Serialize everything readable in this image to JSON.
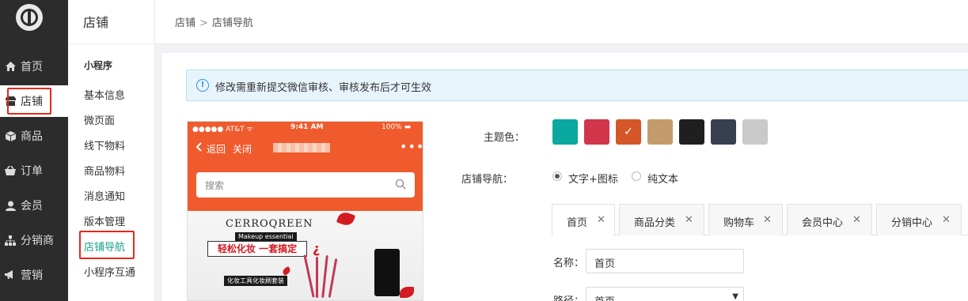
{
  "nav": {
    "items": [
      {
        "label": "首页",
        "icon": "home-icon"
      },
      {
        "label": "店铺",
        "icon": "store-icon"
      },
      {
        "label": "商品",
        "icon": "box-icon"
      },
      {
        "label": "订单",
        "icon": "basket-icon"
      },
      {
        "label": "会员",
        "icon": "user-icon"
      },
      {
        "label": "分销商",
        "icon": "sitemap-icon"
      },
      {
        "label": "营销",
        "icon": "megaphone-icon"
      }
    ]
  },
  "sub": {
    "title": "店铺",
    "group": "小程序",
    "items": [
      "基本信息",
      "微页面",
      "线下物料",
      "商品物料",
      "消息通知",
      "版本管理",
      "店铺导航",
      "小程序互通"
    ]
  },
  "breadcrumb": {
    "parent": "店铺",
    "current": "店铺导航",
    "separator": ">"
  },
  "notice": {
    "text": "修改需重新提交微信审核、审核发布后才可生效"
  },
  "preview": {
    "carrier": "●●●●● AT&T ᯤ",
    "time": "9:41 AM",
    "battery": "100% ▬",
    "back": "返回",
    "close": "关闭",
    "more": "•••",
    "search_placeholder": "搜索",
    "banner_brand": "CERROQREEN",
    "banner_makeup": "Makeup essential",
    "banner_slogan": "轻松化妆  一套搞定",
    "banner_tagline": "化妆工具化妆刷套装"
  },
  "form": {
    "theme_label": "主题色：",
    "theme_colors": [
      "#0aa89e",
      "#d1354a",
      "#d4572a",
      "#c49b6c",
      "#1f1f1f",
      "#383f50",
      "#c9c9c9"
    ],
    "selected_theme_index": 2,
    "nav_label": "店铺导航：",
    "nav_options": [
      "文字+图标",
      "纯文本"
    ],
    "nav_selected": 0,
    "tabs": [
      "首页",
      "商品分类",
      "购物车",
      "会员中心",
      "分销中心"
    ],
    "active_tab": 0,
    "name_label": "名称：",
    "name_value": "首页",
    "path_label": "路径：",
    "path_value": "首页"
  }
}
